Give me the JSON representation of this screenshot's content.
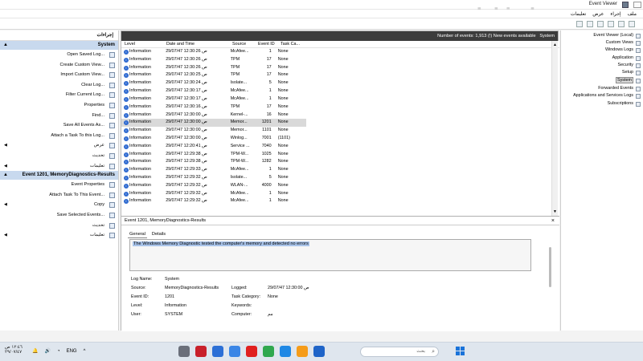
{
  "window": {
    "title": "Event Viewer"
  },
  "watermark": "dubizzle",
  "menu": [
    "ملف",
    "إجراء",
    "عرض",
    "تعليمات"
  ],
  "actions": {
    "title": "إجراءات",
    "section1": "System",
    "items1": [
      {
        "label": "Open Saved Log...",
        "arrow": false
      },
      {
        "label": "Create Custom View...",
        "arrow": false
      },
      {
        "label": "Import Custom View...",
        "arrow": false
      },
      {
        "label": "Clear Log...",
        "arrow": false
      },
      {
        "label": "Filter Current Log...",
        "arrow": false
      },
      {
        "label": "Properties",
        "arrow": false
      },
      {
        "label": "Find...",
        "arrow": false
      },
      {
        "label": "Save All Events As...",
        "arrow": false
      },
      {
        "label": "Attach a Task To this Log...",
        "arrow": false
      },
      {
        "label": "عرض",
        "arrow": true
      },
      {
        "label": "تحديث",
        "arrow": false
      },
      {
        "label": "تعليمات",
        "arrow": true
      }
    ],
    "section2": "Event 1201, MemoryDiagnostics-Results",
    "items2": [
      {
        "label": "Event Properties",
        "arrow": false
      },
      {
        "label": "Attach Task To This Event...",
        "arrow": false
      },
      {
        "label": "Copy",
        "arrow": true
      },
      {
        "label": "Save Selected Events...",
        "arrow": false
      },
      {
        "label": "تحديث",
        "arrow": false
      },
      {
        "label": "تعليمات",
        "arrow": true
      }
    ]
  },
  "center": {
    "event_count": "Number of events: 1,913 (!) New events available",
    "log_name": "System",
    "columns": [
      "Level",
      "Date and Time",
      "Source",
      "Event ID",
      "Task Ca..."
    ],
    "rows": [
      [
        "Information",
        "29/07/47 12:30:26 ص",
        "McAfee...",
        "1",
        "None"
      ],
      [
        "Information",
        "29/07/47 12:30:26 ص",
        "TPM",
        "17",
        "None"
      ],
      [
        "Information",
        "29/07/47 12:30:26 ص",
        "TPM",
        "17",
        "None"
      ],
      [
        "Information",
        "29/07/47 12:30:25 ص",
        "TPM",
        "17",
        "None"
      ],
      [
        "Information",
        "29/07/47 12:30:24 ص",
        "Isolate...",
        "5",
        "None"
      ],
      [
        "Information",
        "29/07/47 12:30:17 ص",
        "McAfee...",
        "1",
        "None"
      ],
      [
        "Information",
        "29/07/47 12:30:17 ص",
        "McAfee...",
        "1",
        "None"
      ],
      [
        "Information",
        "29/07/47 12:30:16 ص",
        "TPM",
        "17",
        "None"
      ],
      [
        "Information",
        "29/07/47 12:30:00 ص",
        "Kernel-...",
        "16",
        "None"
      ],
      [
        "Information",
        "29/07/47 12:30:00 ص",
        "Memor...",
        "1201",
        "None"
      ],
      [
        "Information",
        "29/07/47 12:30:00 ص",
        "Memor...",
        "1101",
        "None"
      ],
      [
        "Information",
        "29/07/47 12:30:00 ص",
        "Winlog...",
        "7001",
        "(1101)"
      ],
      [
        "Information",
        "29/07/47 12:20:41 ص",
        "Service ...",
        "7040",
        "None"
      ],
      [
        "Information",
        "29/07/47 12:29:38 ص",
        "TPM-W...",
        "1025",
        "None"
      ],
      [
        "Information",
        "29/07/47 12:29:38 ص",
        "TPM-W...",
        "1282",
        "None"
      ],
      [
        "Information",
        "29/07/47 12:29:33 ص",
        "McAfee...",
        "1",
        "None"
      ],
      [
        "Information",
        "29/07/47 12:29:32 ص",
        "Isolate...",
        "5",
        "None"
      ],
      [
        "Information",
        "29/07/47 12:29:32 ص",
        "WLAN-...",
        "4000",
        "None"
      ],
      [
        "Information",
        "29/07/47 12:29:32 ص",
        "McAfee...",
        "1",
        "None"
      ],
      [
        "Information",
        "29/07/47 12:29:32 ص",
        "McAfee...",
        "1",
        "None"
      ]
    ],
    "selected_row": 9
  },
  "detail": {
    "header": "Event 1201, MemoryDiagnostics-Results",
    "tabs": [
      "General",
      "Details"
    ],
    "message": "The Windows Memory Diagnostic tested the computer's memory and detected no errors",
    "fields": {
      "log_name_label": "Log Name:",
      "log_name": "System",
      "source_label": "Source:",
      "source": "MemoryDiagnostics-Results",
      "logged_label": "Logged:",
      "logged": "29/07/47 12:30:00 ص",
      "event_id_label": "Event ID:",
      "event_id": "1201",
      "task_label": "Task Category:",
      "task": "None",
      "level_label": "Level:",
      "level": "Information",
      "keywords_label": "Keywords:",
      "user_label": "User:",
      "user": "SYSTEM",
      "computer_label": "Computer:",
      "computer": "مم"
    }
  },
  "tree": [
    {
      "label": "Event Viewer (Local)",
      "selected": false
    },
    {
      "label": "Custom Views",
      "selected": false
    },
    {
      "label": "Windows Logs",
      "selected": false
    },
    {
      "label": "Application",
      "selected": false
    },
    {
      "label": "Security",
      "selected": false
    },
    {
      "label": "Setup",
      "selected": false
    },
    {
      "label": "System",
      "selected": true
    },
    {
      "label": "Forwarded Events",
      "selected": false
    },
    {
      "label": "Applications and Services Logs",
      "selected": false
    },
    {
      "label": "Subscriptions",
      "selected": false
    }
  ],
  "taskbar": {
    "time": "١٢:٤٦ ص",
    "date": "٢٩/٠٧/٤٧",
    "language": "ENG",
    "search_placeholder": "بحث",
    "app_colors": [
      "#6a6f7a",
      "#c8202b",
      "#2b6fd6",
      "#3a86e6",
      "#e02020",
      "#2fa84f",
      "#1e88e5",
      "#f59c1a",
      "#1e64c8"
    ]
  }
}
